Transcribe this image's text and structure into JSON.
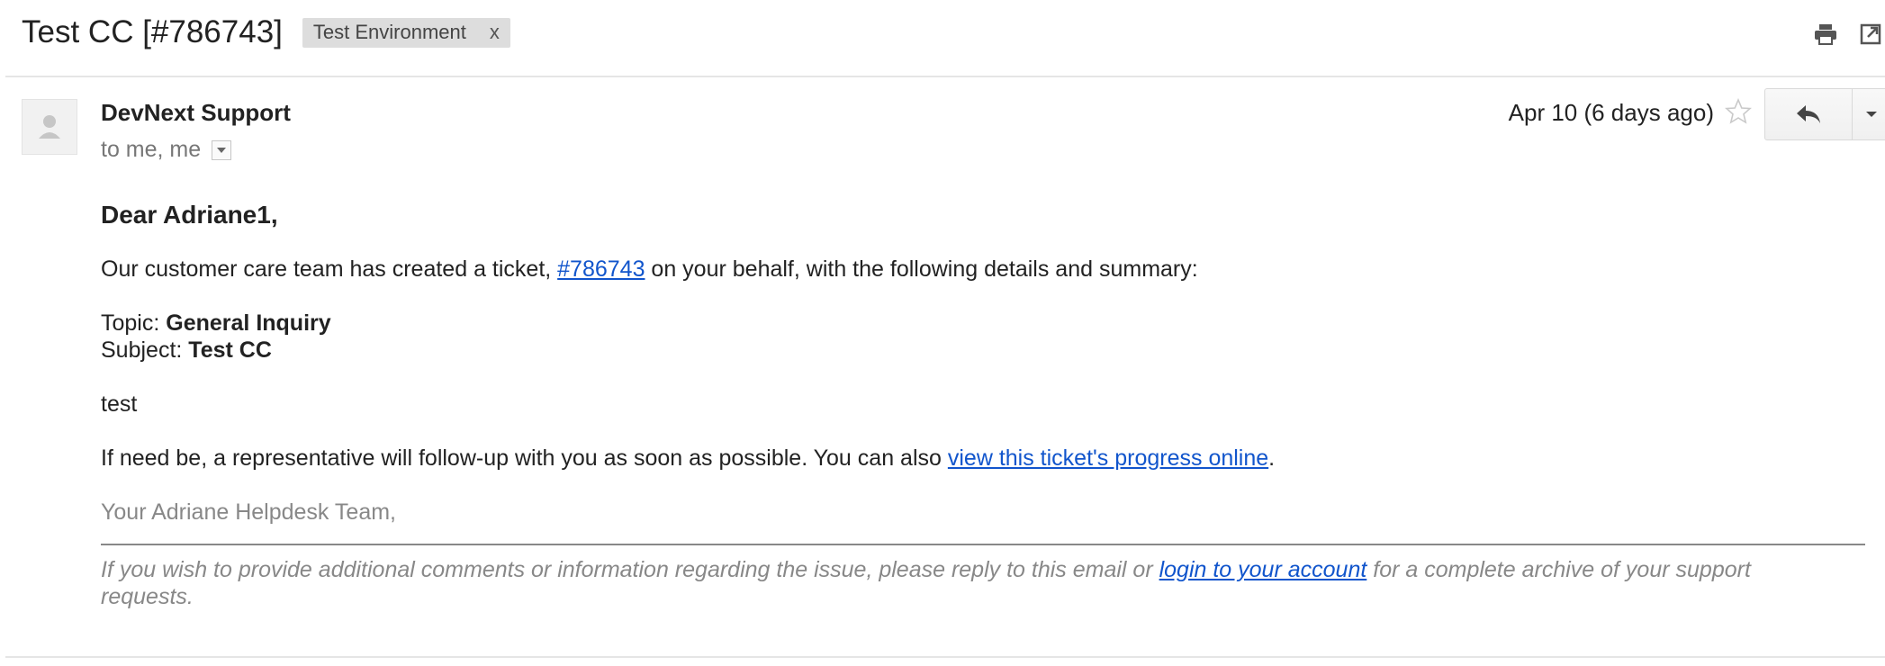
{
  "thread": {
    "subject": "Test CC [#786743]",
    "label": "Test Environment",
    "label_close": "x"
  },
  "toolbar": {
    "print_icon": "print-icon",
    "new_window_icon": "open-in-new-window-icon"
  },
  "message": {
    "sender": "DevNext Support",
    "recipients": "to me, me",
    "date": "Apr 10 (6 days ago)",
    "star_icon": "star-outline-icon",
    "reply_icon": "reply-arrow-icon",
    "more_icon": "caret-down-icon"
  },
  "email": {
    "greeting": "Dear Adriane1,",
    "intro_before": "Our customer care team has created a ticket, ",
    "ticket_link": "#786743",
    "intro_after": " on your behalf, with the following details and summary:",
    "topic_label": "Topic: ",
    "topic_value": "General Inquiry",
    "subject_label": "Subject: ",
    "subject_value": "Test CC",
    "body_text": "test",
    "followup_before": "If need be, a representative will follow-up with you as soon as possible. You can also ",
    "progress_link": "view this ticket's progress online",
    "followup_after": ".",
    "signature": "Your Adriane Helpdesk Team,",
    "footer_before": "If you wish to provide additional comments or information regarding the issue, please reply to this email or ",
    "footer_link": "login to your account",
    "footer_after": " for a complete archive of your support requests."
  },
  "colors": {
    "link": "#1155cc",
    "muted": "#888888",
    "label_bg": "#dddddd"
  }
}
